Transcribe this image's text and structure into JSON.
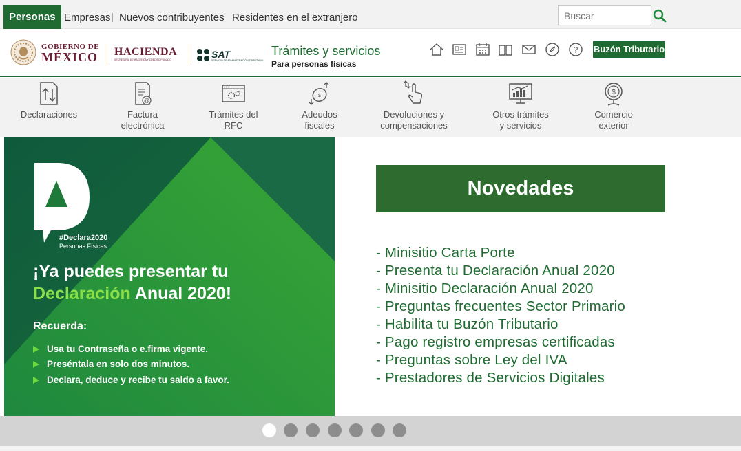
{
  "topnav": {
    "active": "Personas",
    "items": [
      "Empresas",
      "Nuevos contribuyentes",
      "Residentes en el extranjero"
    ],
    "search_placeholder": "Buscar"
  },
  "header": {
    "gob_line1": "GOBIERNO DE",
    "gob_line2": "MÉXICO",
    "hacienda": "HACIENDA",
    "hacienda_sub": "SECRETARÍA DE HACIENDA Y CRÉDITO PÚBLICO",
    "sat": "SAT",
    "sat_sub": "SERVICIO DE ADMINISTRACIÓN TRIBUTARIA",
    "title": "Trámites y servicios",
    "subtitle": "Para personas físicas",
    "buzon": "Buzón Tributario"
  },
  "iconbar": [
    {
      "label": "Declaraciones",
      "icon": "declaraciones-icon"
    },
    {
      "label": "Factura\nelectrónica",
      "icon": "factura-icon"
    },
    {
      "label": "Trámites del\nRFC",
      "icon": "rfc-icon"
    },
    {
      "label": "Adeudos\nfiscales",
      "icon": "adeudos-icon"
    },
    {
      "label": "Devoluciones y\ncompensaciones",
      "icon": "devoluciones-icon"
    },
    {
      "label": "Otros trámites\ny servicios",
      "icon": "otros-tramites-icon"
    },
    {
      "label": "Comercio\nexterior",
      "icon": "comercio-exterior-icon"
    }
  ],
  "banner": {
    "hashtag": "#Declara2020",
    "hashtag_sub": "Personas Físicas",
    "headline_line1": "¡Ya puedes presentar tu",
    "headline_highlight": "Declaración",
    "headline_rest": " Anual 2020!",
    "recuerda": "Recuerda:",
    "bullets": [
      "Usa tu Contraseña o e.firma vigente.",
      "Preséntala en solo dos minutos.",
      "Declara, deduce y recibe tu saldo a favor."
    ]
  },
  "novedades": {
    "title": "Novedades",
    "items": [
      "- Minisitio Carta Porte",
      "- Presenta tu Declaración Anual 2020",
      "- Minisitio Declaración Anual 2020",
      "- Preguntas frecuentes Sector Primario",
      "- Habilita tu Buzón Tributario",
      "- Pago registro empresas certificadas",
      "- Preguntas sobre Ley del IVA",
      "- Prestadores de Servicios Digitales"
    ]
  },
  "carousel": {
    "dot_count": 7,
    "active_index": 0
  },
  "colors": {
    "brand_green": "#1f6b31",
    "novedades_green": "#2d6b2f",
    "gob_maroon": "#691c32"
  }
}
